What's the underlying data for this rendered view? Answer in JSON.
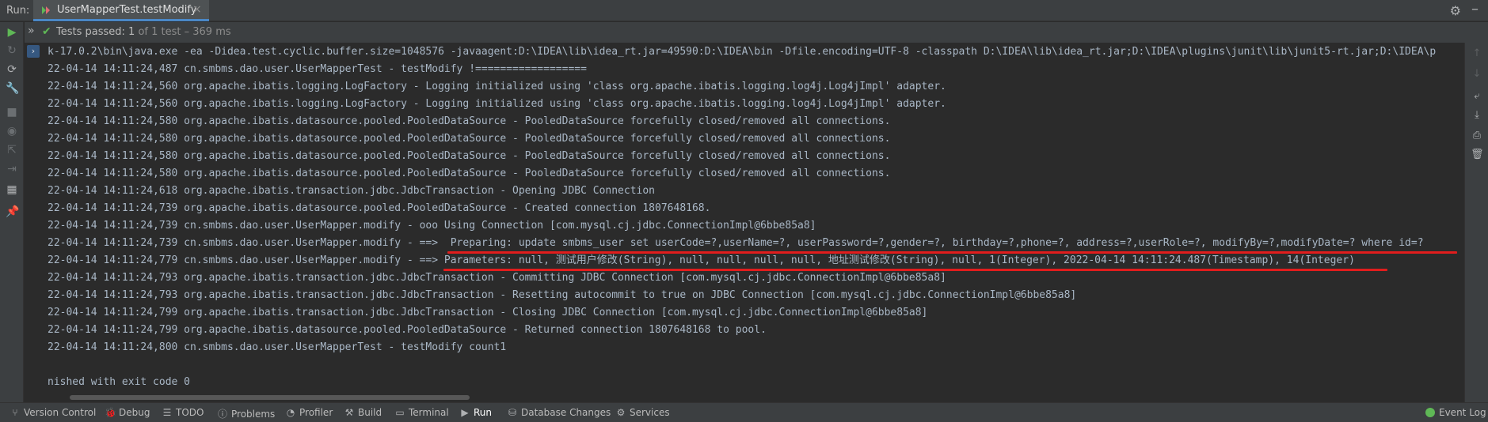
{
  "topbar": {
    "run_label": "Run:",
    "tab_title": "UserMapperTest.testModify",
    "close_glyph": "×",
    "icons": [
      "run-config-icon",
      "close-icon",
      "gear-icon",
      "minimize-icon"
    ]
  },
  "status": {
    "prefix": "Tests passed: ",
    "passed": "1",
    "suffix": " of 1 test – 369 ms"
  },
  "console": {
    "lines": [
      "k-17.0.2\\bin\\java.exe -ea -Didea.test.cyclic.buffer.size=1048576 -javaagent:D:\\IDEA\\lib\\idea_rt.jar=49590:D:\\IDEA\\bin -Dfile.encoding=UTF-8 -classpath D:\\IDEA\\lib\\idea_rt.jar;D:\\IDEA\\plugins\\junit\\lib\\junit5-rt.jar;D:\\IDEA\\p",
      "22-04-14 14:11:24,487 cn.smbms.dao.user.UserMapperTest - testModify !==================",
      "22-04-14 14:11:24,560 org.apache.ibatis.logging.LogFactory - Logging initialized using 'class org.apache.ibatis.logging.log4j.Log4jImpl' adapter.",
      "22-04-14 14:11:24,560 org.apache.ibatis.logging.LogFactory - Logging initialized using 'class org.apache.ibatis.logging.log4j.Log4jImpl' adapter.",
      "22-04-14 14:11:24,580 org.apache.ibatis.datasource.pooled.PooledDataSource - PooledDataSource forcefully closed/removed all connections.",
      "22-04-14 14:11:24,580 org.apache.ibatis.datasource.pooled.PooledDataSource - PooledDataSource forcefully closed/removed all connections.",
      "22-04-14 14:11:24,580 org.apache.ibatis.datasource.pooled.PooledDataSource - PooledDataSource forcefully closed/removed all connections.",
      "22-04-14 14:11:24,580 org.apache.ibatis.datasource.pooled.PooledDataSource - PooledDataSource forcefully closed/removed all connections.",
      "22-04-14 14:11:24,618 org.apache.ibatis.transaction.jdbc.JdbcTransaction - Opening JDBC Connection",
      "22-04-14 14:11:24,739 org.apache.ibatis.datasource.pooled.PooledDataSource - Created connection 1807648168.",
      "22-04-14 14:11:24,739 cn.smbms.dao.user.UserMapper.modify - ooo Using Connection [com.mysql.cj.jdbc.ConnectionImpl@6bbe85a8]",
      "22-04-14 14:11:24,739 cn.smbms.dao.user.UserMapper.modify - ==>  Preparing: update smbms_user set userCode=?,userName=?, userPassword=?,gender=?, birthday=?,phone=?, address=?,userRole=?, modifyBy=?,modifyDate=? where id=?",
      "22-04-14 14:11:24,779 cn.smbms.dao.user.UserMapper.modify - ==> Parameters: null, 测试用户修改(String), null, null, null, null, 地址测试修改(String), null, 1(Integer), 2022-04-14 14:11:24.487(Timestamp), 14(Integer)",
      "22-04-14 14:11:24,793 org.apache.ibatis.transaction.jdbc.JdbcTransaction - Committing JDBC Connection [com.mysql.cj.jdbc.ConnectionImpl@6bbe85a8]",
      "22-04-14 14:11:24,793 org.apache.ibatis.transaction.jdbc.JdbcTransaction - Resetting autocommit to true on JDBC Connection [com.mysql.cj.jdbc.ConnectionImpl@6bbe85a8]",
      "22-04-14 14:11:24,799 org.apache.ibatis.transaction.jdbc.JdbcTransaction - Closing JDBC Connection [com.mysql.cj.jdbc.ConnectionImpl@6bbe85a8]",
      "22-04-14 14:11:24,799 org.apache.ibatis.datasource.pooled.PooledDataSource - Returned connection 1807648168 to pool.",
      "22-04-14 14:11:24,800 cn.smbms.dao.user.UserMapperTest - testModify count1",
      "",
      "nished with exit code 0"
    ]
  },
  "bottombar": {
    "items": [
      {
        "label": "Version Control",
        "icon": "version-control-icon"
      },
      {
        "label": "Debug",
        "icon": "debug-icon"
      },
      {
        "label": "TODO",
        "icon": "todo-icon"
      },
      {
        "label": "Problems",
        "icon": "problems-icon"
      },
      {
        "label": "Profiler",
        "icon": "profiler-icon"
      },
      {
        "label": "Build",
        "icon": "build-icon"
      },
      {
        "label": "Terminal",
        "icon": "terminal-icon"
      },
      {
        "label": "Run",
        "icon": "run-icon"
      },
      {
        "label": "Database Changes",
        "icon": "database-icon"
      },
      {
        "label": "Services",
        "icon": "services-icon"
      }
    ],
    "event_log": "Event Log"
  },
  "colors": {
    "accent": "#4a88c7",
    "success": "#5fb856",
    "annotation": "#e11d1d"
  }
}
